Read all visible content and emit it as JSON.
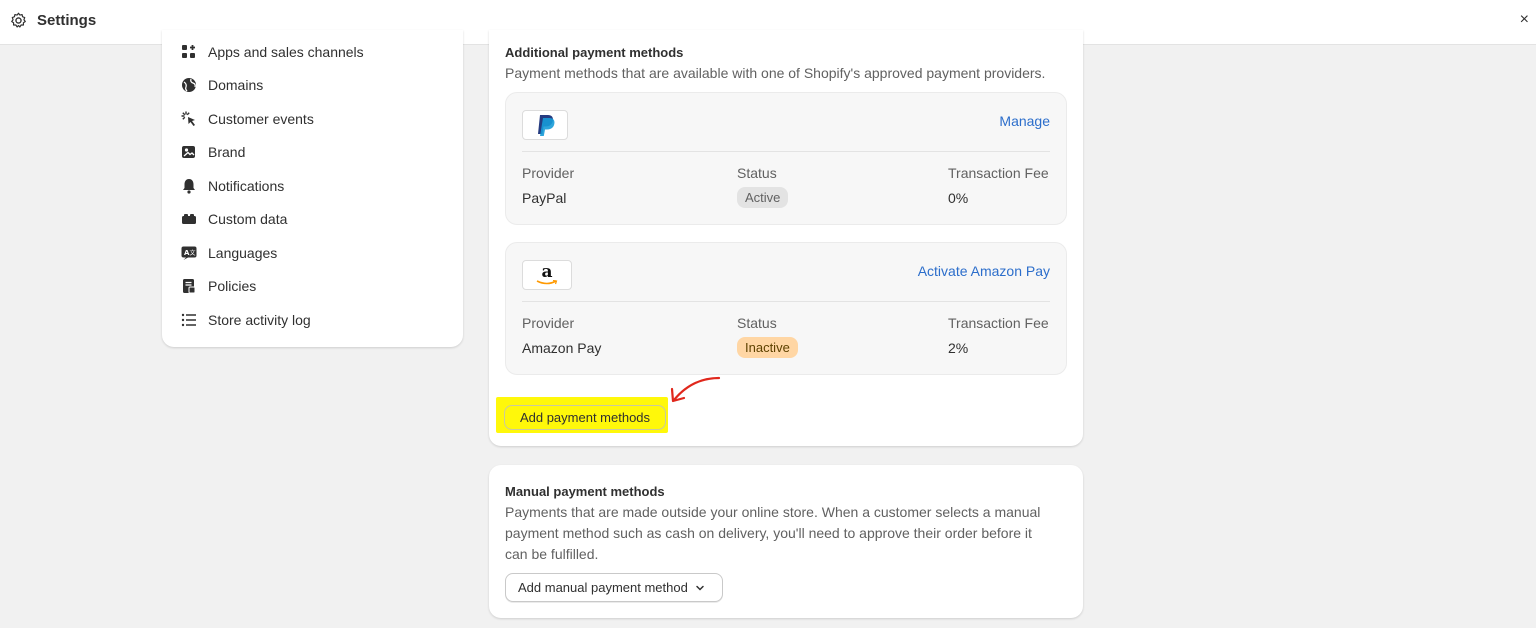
{
  "header": {
    "title": "Settings",
    "close_label": "×"
  },
  "sidebar": {
    "items": [
      {
        "label": "Apps and sales channels",
        "icon": "apps-icon"
      },
      {
        "label": "Domains",
        "icon": "globe-icon"
      },
      {
        "label": "Customer events",
        "icon": "cursor-click-icon"
      },
      {
        "label": "Brand",
        "icon": "brand-image-icon"
      },
      {
        "label": "Notifications",
        "icon": "bell-icon"
      },
      {
        "label": "Custom data",
        "icon": "custom-data-icon"
      },
      {
        "label": "Languages",
        "icon": "language-icon"
      },
      {
        "label": "Policies",
        "icon": "policy-icon"
      },
      {
        "label": "Store activity log",
        "icon": "list-icon"
      }
    ]
  },
  "additional": {
    "title": "Additional payment methods",
    "subtitle": "Payment methods that are available with one of Shopify's approved payment providers.",
    "providers": [
      {
        "logo": "paypal-logo",
        "action_label": "Manage",
        "provider_header": "Provider",
        "status_header": "Status",
        "fee_header": "Transaction Fee",
        "provider": "PayPal",
        "status": "Active",
        "fee": "0%"
      },
      {
        "logo": "amazon-logo",
        "logo_text": "a",
        "action_label": "Activate Amazon Pay",
        "provider_header": "Provider",
        "status_header": "Status",
        "fee_header": "Transaction Fee",
        "provider": "Amazon Pay",
        "status": "Inactive",
        "fee": "2%"
      }
    ],
    "add_button_label": "Add payment methods"
  },
  "manual": {
    "title": "Manual payment methods",
    "description_lines": [
      "Payments that are made outside your online store. When a customer selects a manual",
      "payment method such as cash on delivery, you'll need to approve their order before it",
      "can be fulfilled."
    ],
    "add_button_label": "Add manual payment method"
  },
  "colors": {
    "highlight": "#fff80a",
    "link": "#2c6ecb",
    "annotation_arrow": "#e0271c",
    "badge_inactive": "#ffd6a4"
  }
}
